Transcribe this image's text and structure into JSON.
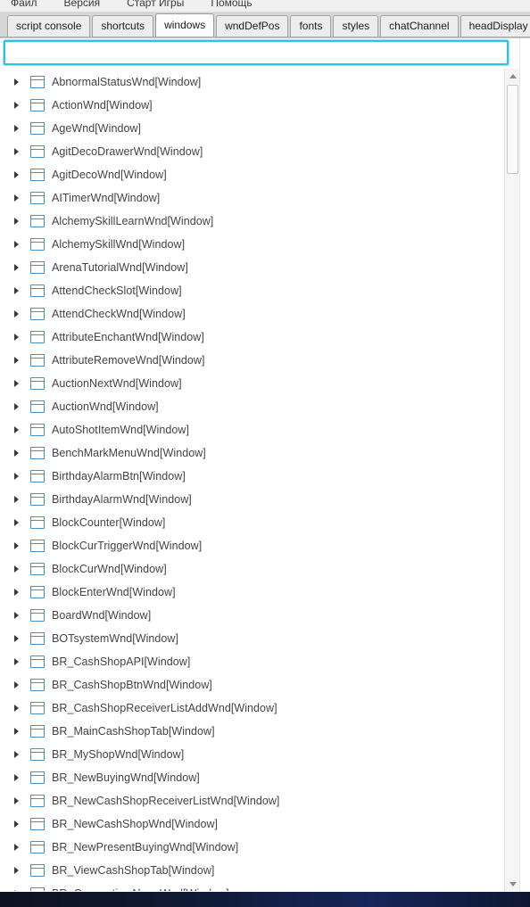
{
  "menubar": {
    "items": [
      {
        "label": "Файл"
      },
      {
        "label": "Версия"
      },
      {
        "label": "Старт Игры"
      },
      {
        "label": "Помощь"
      }
    ]
  },
  "tabs": [
    {
      "label": "script console",
      "selected": false
    },
    {
      "label": "shortcuts",
      "selected": false
    },
    {
      "label": "windows",
      "selected": true
    },
    {
      "label": "wndDefPos",
      "selected": false
    },
    {
      "label": "fonts",
      "selected": false
    },
    {
      "label": "styles",
      "selected": false
    },
    {
      "label": "chatChannel",
      "selected": false
    },
    {
      "label": "headDisplay",
      "selected": false
    }
  ],
  "search": {
    "value": "",
    "placeholder": ""
  },
  "tree": {
    "icon_name": "window-icon",
    "expander_icon_name": "triangle-right-icon",
    "items": [
      {
        "label": "AbnormalStatusWnd[Window]"
      },
      {
        "label": "ActionWnd[Window]"
      },
      {
        "label": "AgeWnd[Window]"
      },
      {
        "label": "AgitDecoDrawerWnd[Window]"
      },
      {
        "label": "AgitDecoWnd[Window]"
      },
      {
        "label": "AITimerWnd[Window]"
      },
      {
        "label": "AlchemySkillLearnWnd[Window]"
      },
      {
        "label": "AlchemySkillWnd[Window]"
      },
      {
        "label": "ArenaTutorialWnd[Window]"
      },
      {
        "label": "AttendCheckSlot[Window]"
      },
      {
        "label": "AttendCheckWnd[Window]"
      },
      {
        "label": "AttributeEnchantWnd[Window]"
      },
      {
        "label": "AttributeRemoveWnd[Window]"
      },
      {
        "label": "AuctionNextWnd[Window]"
      },
      {
        "label": "AuctionWnd[Window]"
      },
      {
        "label": "AutoShotItemWnd[Window]"
      },
      {
        "label": "BenchMarkMenuWnd[Window]"
      },
      {
        "label": "BirthdayAlarmBtn[Window]"
      },
      {
        "label": "BirthdayAlarmWnd[Window]"
      },
      {
        "label": "BlockCounter[Window]"
      },
      {
        "label": "BlockCurTriggerWnd[Window]"
      },
      {
        "label": "BlockCurWnd[Window]"
      },
      {
        "label": "BlockEnterWnd[Window]"
      },
      {
        "label": "BoardWnd[Window]"
      },
      {
        "label": "BOTsystemWnd[Window]"
      },
      {
        "label": "BR_CashShopAPI[Window]"
      },
      {
        "label": "BR_CashShopBtnWnd[Window]"
      },
      {
        "label": "BR_CashShopReceiverListAddWnd[Window]"
      },
      {
        "label": "BR_MainCashShopTab[Window]"
      },
      {
        "label": "BR_MyShopWnd[Window]"
      },
      {
        "label": "BR_NewBuyingWnd[Window]"
      },
      {
        "label": "BR_NewCashShopReceiverListWnd[Window]"
      },
      {
        "label": "BR_NewCashShopWnd[Window]"
      },
      {
        "label": "BR_NewPresentBuyingWnd[Window]"
      },
      {
        "label": "BR_ViewCashShopTab[Window]"
      },
      {
        "label": "BR_ConnectionAlarmWnd[Window]"
      }
    ]
  },
  "scrollbar": {
    "up_icon": "chevron-up-icon",
    "down_icon": "chevron-down-icon"
  },
  "colors": {
    "focus_border": "#2bc4e8",
    "icon_blue": "#4a90c4",
    "tab_selected_bg": "#fdfdfd",
    "tab_bg": "#ededed",
    "tabstrip_bg": "#d6d6d6",
    "text": "#444444",
    "taskbar": "#16255a"
  }
}
